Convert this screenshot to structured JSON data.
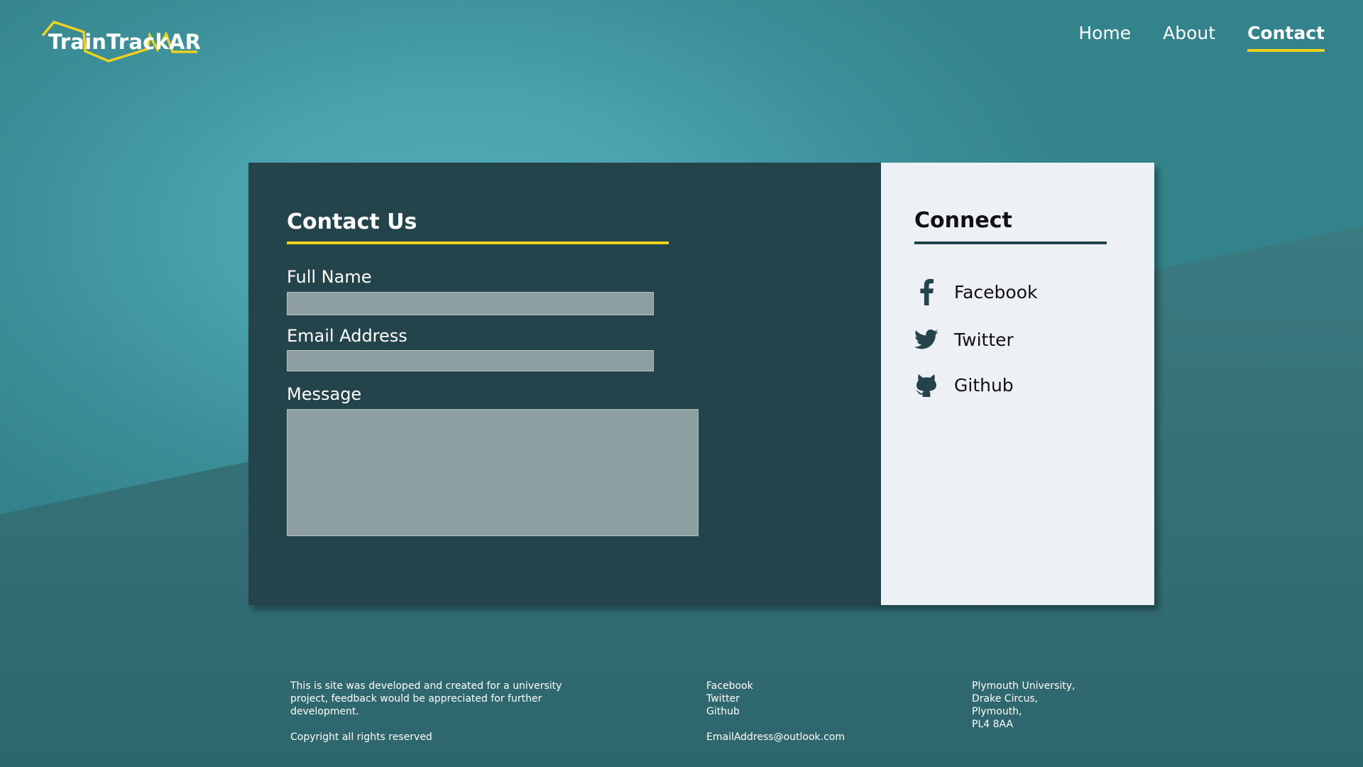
{
  "header": {
    "logo_text": "TrainTrackAR",
    "nav": [
      {
        "label": "Home",
        "active": false
      },
      {
        "label": "About",
        "active": false
      },
      {
        "label": "Contact",
        "active": true
      }
    ]
  },
  "contact_form": {
    "title": "Contact Us",
    "full_name_label": "Full Name",
    "full_name_value": "",
    "email_label": "Email Address",
    "email_value": "",
    "message_label": "Message",
    "message_value": ""
  },
  "connect": {
    "title": "Connect",
    "items": [
      {
        "label": "Facebook",
        "icon": "facebook-icon"
      },
      {
        "label": "Twitter",
        "icon": "twitter-icon"
      },
      {
        "label": "Github",
        "icon": "github-icon"
      }
    ]
  },
  "footer": {
    "about_text": "This is site was developed and created for a university project, feedback would be appreciated for further development.",
    "copyright": "Copyright all rights reserved",
    "links": [
      "Facebook",
      "Twitter",
      "Github"
    ],
    "email": "EmailAddress@outlook.com",
    "address": [
      "Plymouth University,",
      "Drake Circus,",
      "Plymouth,",
      "PL4 8AA"
    ]
  },
  "colors": {
    "accent": "#f1d21b",
    "panel_dark": "#24444b",
    "panel_light": "#edf0f4",
    "background": "#4aa3ad"
  }
}
